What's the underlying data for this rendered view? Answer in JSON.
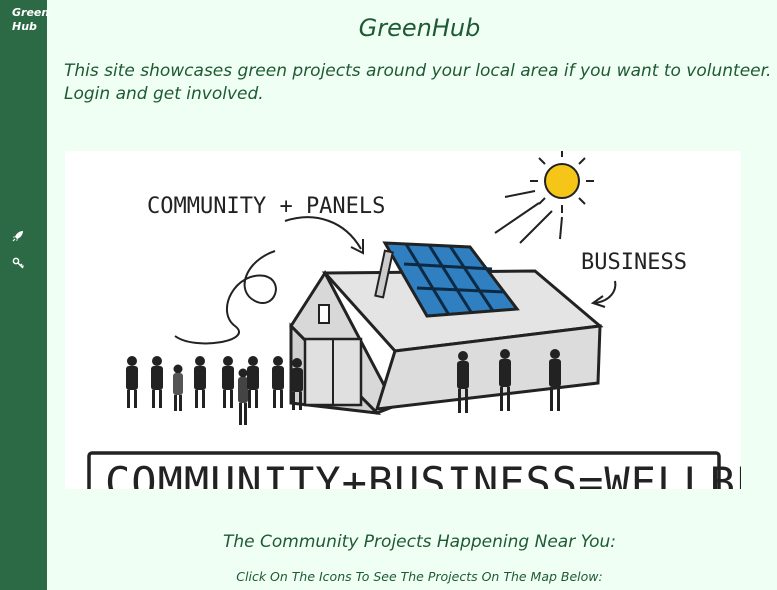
{
  "sidebar": {
    "brand": "Green Hub",
    "nav_icons": [
      "rocket-icon",
      "key-icon"
    ]
  },
  "header": {
    "title": "GreenHub"
  },
  "intro": "This site showcases green projects around your local area if you want to volunteer. Login and get involved.",
  "illustration": {
    "label_left": "COMMUNITY + PANELS",
    "label_right": "BUSINESS",
    "banner": "COMMUNITY+BUSINESS=WELLBEING"
  },
  "projects": {
    "heading": "The Community Projects Happening Near You:",
    "instruction": "Click On The Icons To See The Projects On The Map Below:"
  },
  "colors": {
    "sidebar": "#2b6a45",
    "background": "#f0fff4",
    "text": "#1e5a34",
    "solar_panel": "#2f7fc1",
    "sun": "#f5c518"
  }
}
